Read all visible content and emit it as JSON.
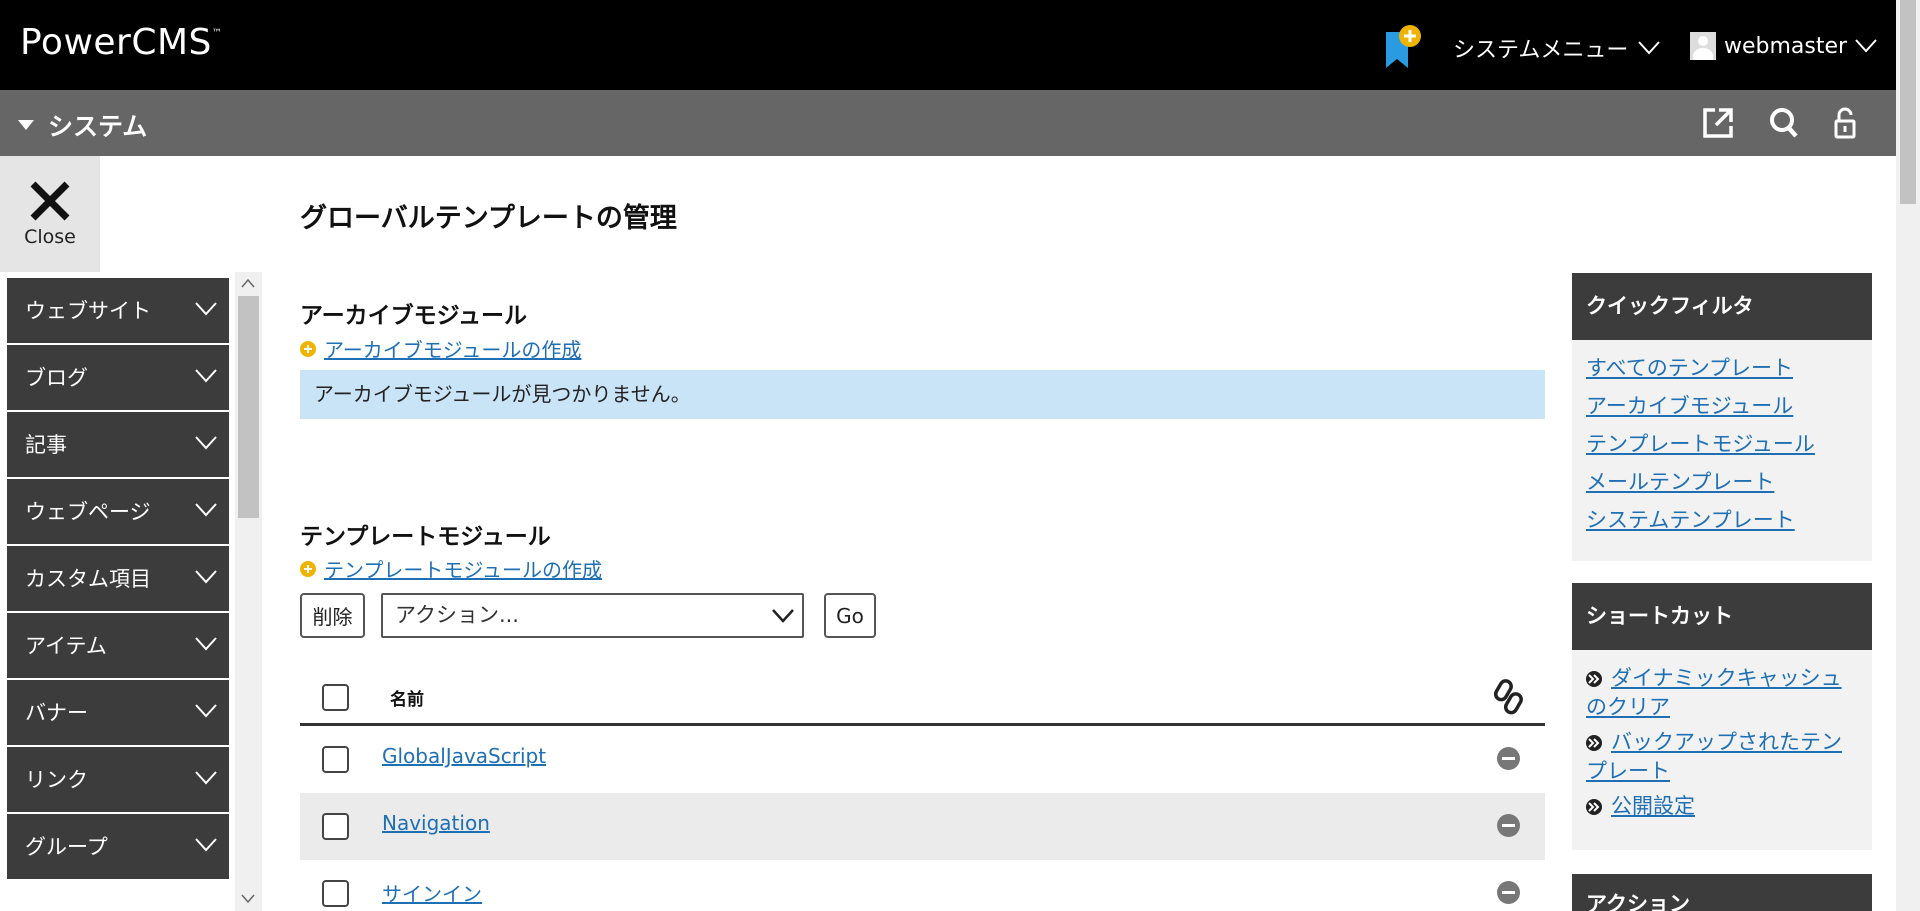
{
  "header": {
    "logo": "PowerCMS",
    "logo_tm": "™",
    "system_menu": "システムメニュー",
    "user": "webmaster"
  },
  "scopebar": {
    "scope_label": "システム"
  },
  "close": {
    "label": "Close"
  },
  "sidebar": {
    "items": [
      {
        "label": "ウェブサイト"
      },
      {
        "label": "ブログ"
      },
      {
        "label": "記事"
      },
      {
        "label": "ウェブページ"
      },
      {
        "label": "カスタム項目"
      },
      {
        "label": "アイテム"
      },
      {
        "label": "バナー"
      },
      {
        "label": "リンク"
      },
      {
        "label": "グループ"
      }
    ]
  },
  "main": {
    "page_title": "グローバルテンプレートの管理",
    "archive": {
      "title": "アーカイブモジュール",
      "create_link": "アーカイブモジュールの作成",
      "notice": "アーカイブモジュールが見つかりません。"
    },
    "template": {
      "title": "テンプレートモジュール",
      "create_link": "テンプレートモジュールの作成",
      "delete_label": "削除",
      "action_select": "アクション...",
      "go_label": "Go",
      "col_name": "名前",
      "rows": [
        {
          "name": "GlobalJavaScript"
        },
        {
          "name": "Navigation"
        },
        {
          "name": "サインイン"
        }
      ]
    }
  },
  "right": {
    "quick_filter": {
      "title": "クイックフィルタ",
      "links": [
        "すべてのテンプレート",
        "アーカイブモジュール",
        "テンプレートモジュール",
        "メールテンプレート",
        "システムテンプレート"
      ]
    },
    "shortcut": {
      "title": "ショートカット",
      "items": [
        "ダイナミックキャッシュのクリア",
        "バックアップされたテンプレート",
        "公開設定"
      ]
    },
    "actions": {
      "title": "アクション"
    }
  },
  "colors": {
    "topbar": "#000000",
    "scopebar": "#666666",
    "sidebar": "#3c3c3c",
    "link": "#1f6fb5",
    "notice": "#c9e3f7",
    "accent": "#f0b400"
  }
}
